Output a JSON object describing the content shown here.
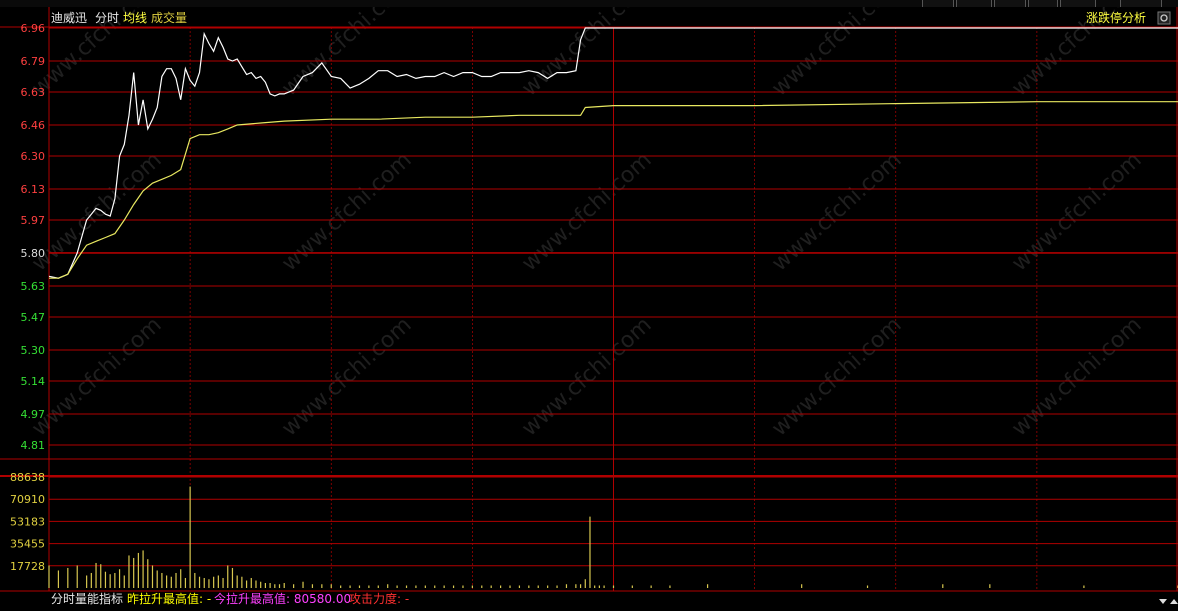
{
  "header": {
    "stock_name": "迪威迅",
    "mode_label": "分时",
    "avg_line_label": "均线",
    "volume_label": "成交量",
    "limit_analysis_button": "涨跌停分析"
  },
  "footer": {
    "indicator_name": "分时量能指标",
    "yesterday_label": "昨拉升最高值: -",
    "today_label": "今拉升最高值: 80580.00",
    "attack_label": "攻击力度: -"
  },
  "watermark": "www.cfchi.com",
  "colors": {
    "price_line": "#ffffff",
    "avg_line": "#e8e860",
    "grid_red": "#b00000",
    "grid_dark": "#5a0000",
    "label_red": "#ff4040",
    "label_green": "#35e035",
    "label_mid": "#dddddd",
    "volume_bar": "#d8c850",
    "volume_label": "#e0d040",
    "footer_yellow": "#ffff00",
    "footer_magenta": "#ff40ff",
    "footer_red": "#ff3030"
  },
  "chart_data": [
    {
      "type": "line",
      "panel": "price",
      "y_ticks": [
        "6.96",
        "6.79",
        "6.63",
        "6.46",
        "6.30",
        "6.13",
        "5.97",
        "5.80",
        "5.63",
        "5.47",
        "5.30",
        "5.14",
        "4.97",
        "4.81"
      ],
      "ylim": [
        4.81,
        6.96
      ],
      "prev_close": 5.8,
      "xlim": [
        0,
        240
      ],
      "series": [
        {
          "key": "price",
          "x": [
            0,
            2,
            4,
            6,
            8,
            9,
            10,
            11,
            12,
            13,
            14,
            15,
            16,
            17,
            18,
            19,
            20,
            21,
            22,
            23,
            24,
            25,
            26,
            27,
            28,
            29,
            30,
            31,
            32,
            33,
            34,
            35,
            36,
            37,
            38,
            39,
            40,
            41,
            42,
            43,
            44,
            45,
            46,
            47,
            48,
            49,
            50,
            52,
            54,
            56,
            58,
            60,
            62,
            64,
            66,
            68,
            70,
            72,
            74,
            76,
            78,
            80,
            82,
            84,
            86,
            88,
            90,
            92,
            94,
            96,
            98,
            100,
            102,
            104,
            106,
            108,
            110,
            112,
            113,
            114,
            240
          ],
          "values": [
            5.68,
            5.67,
            5.69,
            5.8,
            5.97,
            6.0,
            6.03,
            6.02,
            6.0,
            5.99,
            6.08,
            6.3,
            6.36,
            6.51,
            6.73,
            6.46,
            6.59,
            6.44,
            6.49,
            6.55,
            6.71,
            6.75,
            6.75,
            6.7,
            6.59,
            6.75,
            6.69,
            6.66,
            6.73,
            6.93,
            6.88,
            6.84,
            6.91,
            6.86,
            6.8,
            6.79,
            6.8,
            6.76,
            6.72,
            6.73,
            6.7,
            6.71,
            6.68,
            6.62,
            6.61,
            6.62,
            6.62,
            6.64,
            6.71,
            6.73,
            6.78,
            6.71,
            6.7,
            6.65,
            6.67,
            6.7,
            6.74,
            6.74,
            6.71,
            6.72,
            6.7,
            6.71,
            6.71,
            6.73,
            6.71,
            6.73,
            6.73,
            6.71,
            6.71,
            6.73,
            6.73,
            6.73,
            6.74,
            6.73,
            6.7,
            6.73,
            6.73,
            6.74,
            6.9,
            6.96,
            6.96
          ]
        },
        {
          "key": "avg",
          "x": [
            0,
            2,
            4,
            6,
            8,
            10,
            12,
            14,
            16,
            18,
            20,
            22,
            24,
            26,
            28,
            30,
            32,
            34,
            36,
            38,
            40,
            45,
            50,
            60,
            70,
            80,
            90,
            100,
            113,
            114,
            120,
            150,
            180,
            210,
            240
          ],
          "values": [
            5.67,
            5.67,
            5.69,
            5.77,
            5.84,
            5.86,
            5.88,
            5.9,
            5.97,
            6.05,
            6.12,
            6.16,
            6.18,
            6.2,
            6.23,
            6.39,
            6.41,
            6.41,
            6.42,
            6.44,
            6.46,
            6.47,
            6.48,
            6.49,
            6.49,
            6.5,
            6.5,
            6.51,
            6.51,
            6.55,
            6.56,
            6.56,
            6.57,
            6.58,
            6.58
          ]
        }
      ]
    },
    {
      "type": "bar",
      "panel": "volume",
      "y_ticks": [
        "88638",
        "70910",
        "53183",
        "35455",
        "17728"
      ],
      "ylim": [
        0,
        88638
      ],
      "xlim": [
        0,
        240
      ],
      "x": [
        0,
        2,
        4,
        6,
        8,
        9,
        10,
        11,
        12,
        13,
        14,
        15,
        16,
        17,
        18,
        19,
        20,
        21,
        22,
        23,
        24,
        25,
        26,
        27,
        28,
        29,
        30,
        31,
        32,
        33,
        34,
        35,
        36,
        37,
        38,
        39,
        40,
        41,
        42,
        43,
        44,
        45,
        46,
        47,
        48,
        49,
        50,
        52,
        54,
        56,
        58,
        60,
        62,
        64,
        66,
        68,
        70,
        72,
        74,
        76,
        78,
        80,
        82,
        84,
        86,
        88,
        90,
        92,
        94,
        96,
        98,
        100,
        102,
        104,
        106,
        108,
        110,
        112,
        113,
        114,
        115,
        116,
        117,
        118,
        120,
        124,
        128,
        132,
        140,
        160,
        174,
        190,
        200,
        220,
        240
      ],
      "values": [
        18000,
        14000,
        16000,
        18000,
        10000,
        12000,
        20000,
        19000,
        13000,
        11000,
        12000,
        15000,
        10000,
        26000,
        24000,
        28000,
        30000,
        23000,
        18000,
        14000,
        12000,
        10000,
        9000,
        12000,
        15000,
        8000,
        81000,
        12000,
        9000,
        8000,
        7000,
        9000,
        10000,
        8000,
        18000,
        16000,
        10000,
        9000,
        6000,
        8000,
        6000,
        5000,
        4000,
        4000,
        3000,
        3000,
        4000,
        3000,
        5000,
        3000,
        3000,
        3000,
        2000,
        2000,
        2000,
        2000,
        2000,
        3000,
        2000,
        2000,
        2000,
        2000,
        2000,
        2000,
        2000,
        2000,
        2000,
        2000,
        2000,
        2000,
        2000,
        2000,
        2000,
        2000,
        2000,
        2000,
        3000,
        3000,
        3000,
        7000,
        57000,
        2000,
        2000,
        2000,
        2000,
        2000,
        2000,
        2000,
        3000,
        3000,
        2000,
        3000,
        3000,
        2000,
        2000,
        2000,
        1500
      ]
    }
  ]
}
